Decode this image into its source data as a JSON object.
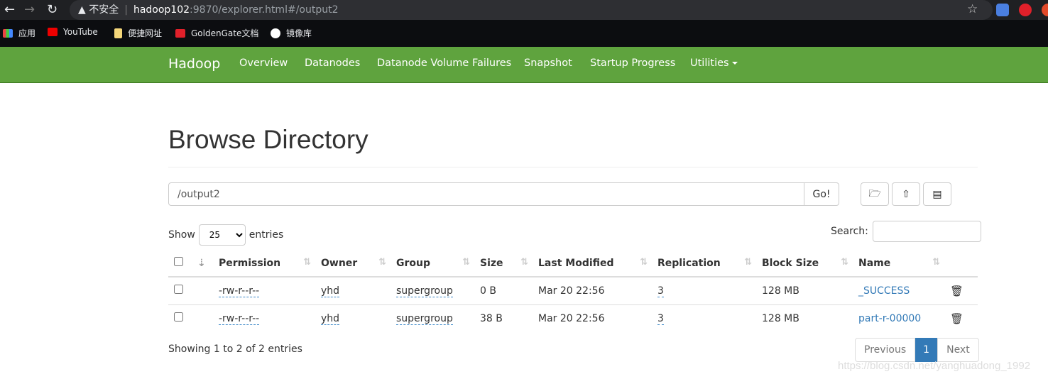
{
  "browser": {
    "security_label": "不安全",
    "url_host": "hadoop102",
    "url_path": ":9870/explorer.html#/output2",
    "bookmarks": [
      {
        "label": "应用",
        "icon": "apps-grid-icon"
      },
      {
        "label": "YouTube",
        "icon": "youtube-icon"
      },
      {
        "label": "便捷网址",
        "icon": "folder-icon"
      },
      {
        "label": "GoldenGate文档",
        "icon": "oracle-icon"
      },
      {
        "label": "镜像库",
        "icon": "globe-icon"
      }
    ]
  },
  "navbar": {
    "brand": "Hadoop",
    "items": [
      "Overview",
      "Datanodes",
      "Datanode Volume Failures",
      "Snapshot",
      "Startup Progress",
      "Utilities"
    ],
    "color": "#5fa33e"
  },
  "page": {
    "title": "Browse Directory",
    "path_value": "/output2",
    "go_label": "Go!",
    "show_label": "Show",
    "entries_value": "25",
    "entries_label": "entries",
    "search_label": "Search:",
    "columns": [
      "Permission",
      "Owner",
      "Group",
      "Size",
      "Last Modified",
      "Replication",
      "Block Size",
      "Name"
    ],
    "rows": [
      {
        "permission": "-rw-r--r--",
        "owner": "yhd",
        "group": "supergroup",
        "size": "0 B",
        "modified": "Mar 20 22:56",
        "replication": "3",
        "block_size": "128 MB",
        "name": "_SUCCESS"
      },
      {
        "permission": "-rw-r--r--",
        "owner": "yhd",
        "group": "supergroup",
        "size": "38 B",
        "modified": "Mar 20 22:56",
        "replication": "3",
        "block_size": "128 MB",
        "name": "part-r-00000"
      }
    ],
    "info": "Showing 1 to 2 of 2 entries",
    "pager": {
      "prev": "Previous",
      "current": "1",
      "next": "Next"
    },
    "watermark": "https://blog.csdn.net/yanghuadong_1992"
  }
}
